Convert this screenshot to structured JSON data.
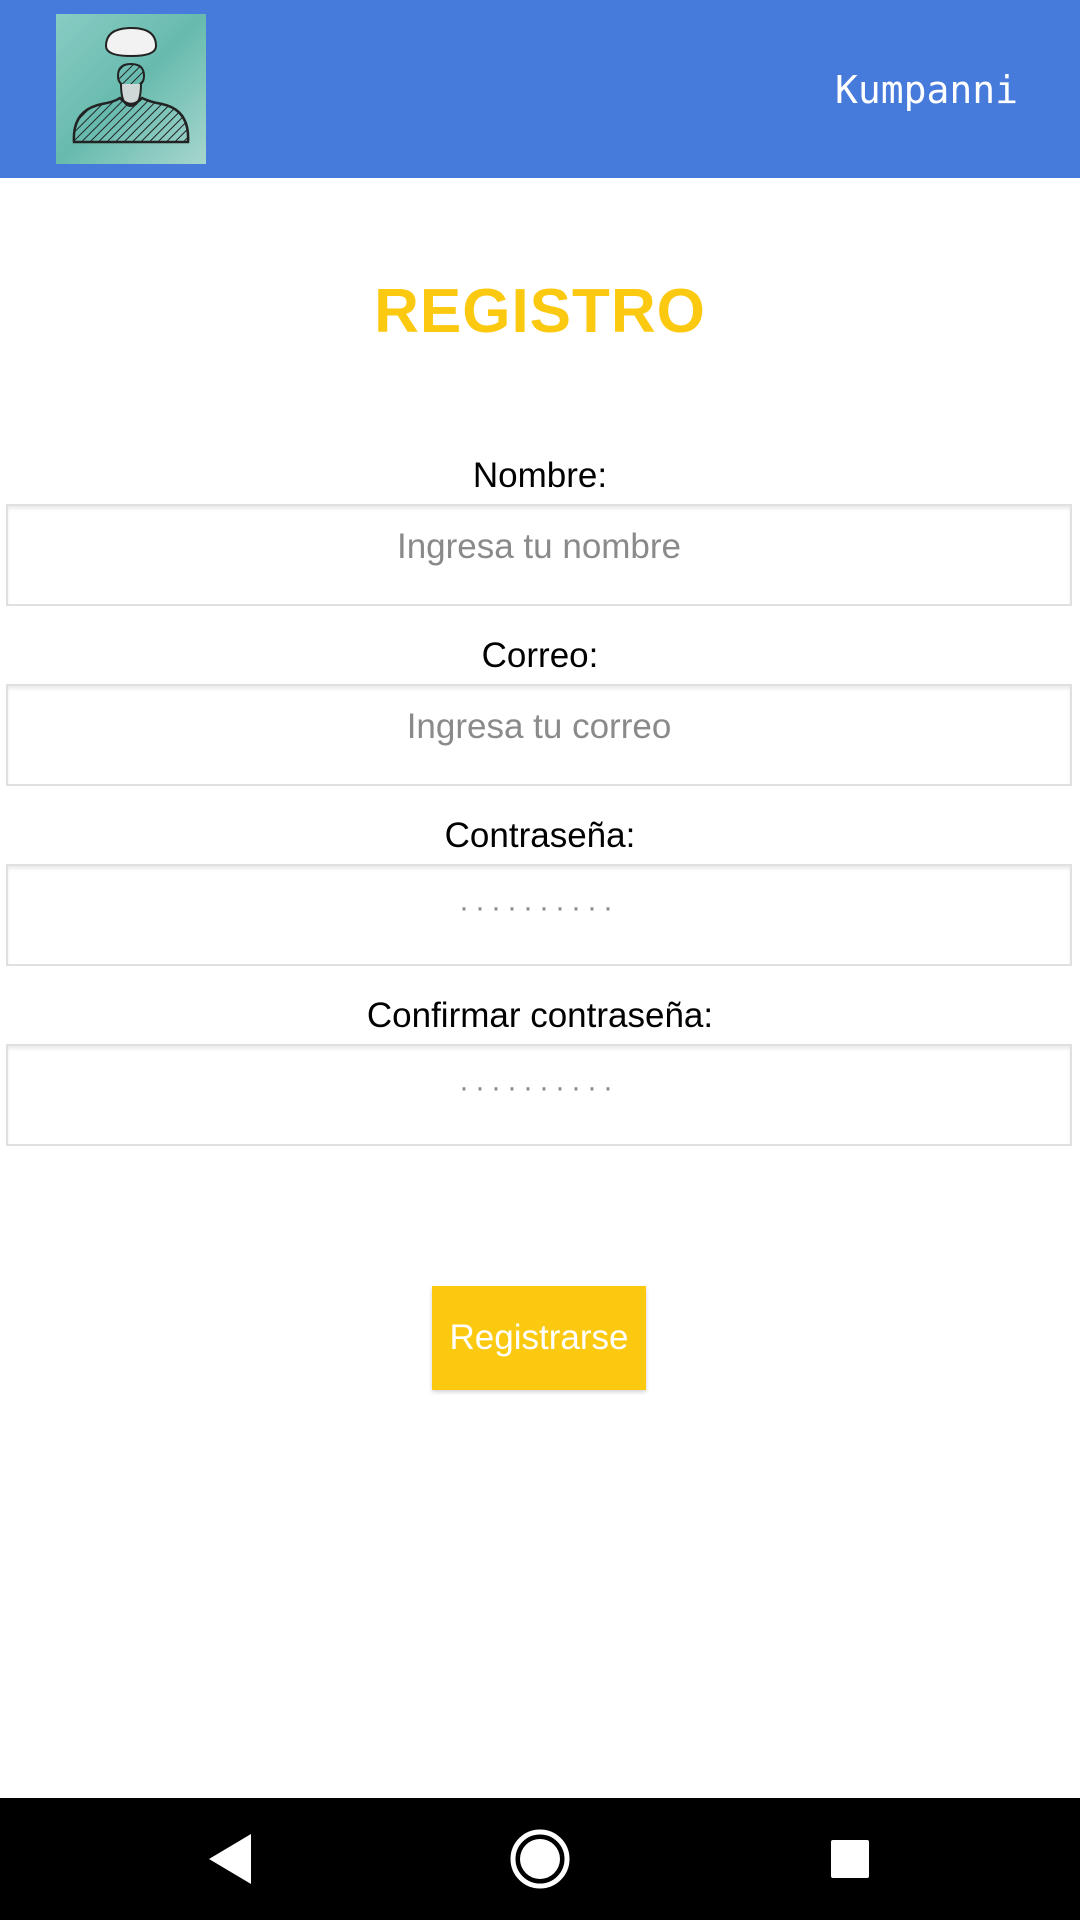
{
  "header": {
    "brand": "Kumpanni",
    "background": "#467adb",
    "logo_icon": "avatar-sketch-icon"
  },
  "page": {
    "title": "REGISTRO",
    "title_color": "#fcc911"
  },
  "form": {
    "name": {
      "label": "Nombre:",
      "placeholder": "Ingresa tu nombre"
    },
    "email": {
      "label": "Correo:",
      "placeholder": "Ingresa tu correo"
    },
    "password": {
      "label": "Contraseña:",
      "masked_value": "··········"
    },
    "confirm_password": {
      "label": "Confirmar contraseña:",
      "masked_value": "··········"
    },
    "submit_label": "Registrarse",
    "submit_color": "#fcc911"
  },
  "navbar": {
    "back_icon": "back-triangle-icon",
    "home_icon": "home-circle-icon",
    "recents_icon": "recents-square-icon"
  }
}
